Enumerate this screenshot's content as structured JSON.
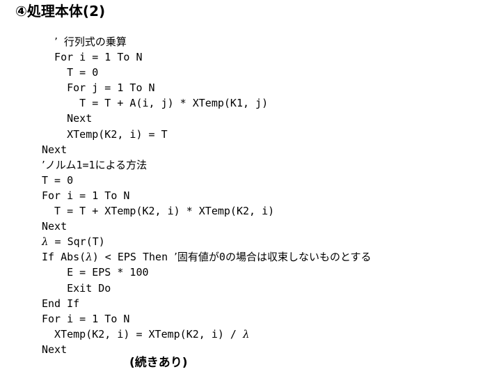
{
  "slide": {
    "title": "④処理本体(2)",
    "footer": "(続きあり)",
    "background_color": "#ffffff",
    "text_color": "#000000"
  },
  "code": {
    "language": "Visual Basic",
    "lines": [
      {
        "indent": 1,
        "text": "’ 行列式の乗算"
      },
      {
        "indent": 1,
        "text": "For i = 1 To N"
      },
      {
        "indent": 2,
        "text": "T = 0"
      },
      {
        "indent": 2,
        "text": "For j = 1 To N"
      },
      {
        "indent": 3,
        "text": "T = T + A(i, j) * XTemp(K1, j)"
      },
      {
        "indent": 2,
        "text": "Next"
      },
      {
        "indent": 2,
        "text": "XTemp(K2, i) = T"
      },
      {
        "indent": 0,
        "text": "Next"
      },
      {
        "indent": 0,
        "text": "’ノルム1=1による方法"
      },
      {
        "indent": 0,
        "text": "T = 0"
      },
      {
        "indent": 0,
        "text": "For i = 1 To N"
      },
      {
        "indent": 1,
        "text": "T = T + XTemp(K2, i) * XTemp(K2, i)"
      },
      {
        "indent": 0,
        "text": "Next"
      },
      {
        "indent": 0,
        "text": "λ = Sqr(T)"
      },
      {
        "indent": 0,
        "text": "If Abs(λ) < EPS Then ’固有値が0の場合は収束しないものとする"
      },
      {
        "indent": 2,
        "text": "E = EPS * 100"
      },
      {
        "indent": 2,
        "text": "Exit Do"
      },
      {
        "indent": 0,
        "text": "End If"
      },
      {
        "indent": 0,
        "text": "For i = 1 To N"
      },
      {
        "indent": 1,
        "text": "XTemp(K2, i) = XTemp(K2, i) / λ"
      },
      {
        "indent": 0,
        "text": "Next"
      }
    ]
  }
}
